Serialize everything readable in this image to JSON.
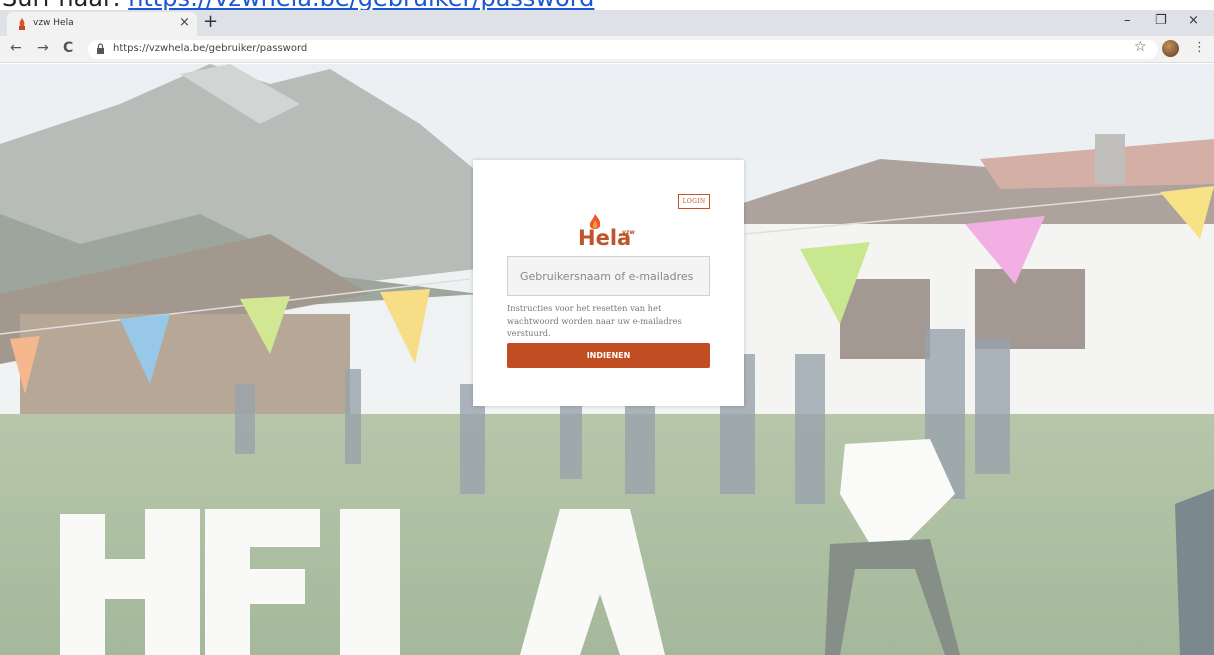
{
  "doc_header": {
    "prefix": "Surf naar:",
    "link": "https://vzwhela.be/gebruiker/password"
  },
  "browser": {
    "tab_title": "vzw Hela",
    "tab_close": "×",
    "new_tab": "+",
    "url": "https://vzwhela.be/gebruiker/password",
    "window_controls": {
      "minimize": "–",
      "restore": "❐",
      "close": "×"
    }
  },
  "nav": {
    "back": "←",
    "forward": "→",
    "reload": "C",
    "star": "☆",
    "menu": "⋮"
  },
  "card": {
    "login_label": "LOGIN",
    "logo_text": "Hela",
    "logo_vzw": "vzw",
    "input_placeholder": "Gebruikersnaam of e-mailadres",
    "instructions": "Instructies voor het resetten van het wachtwoord worden naar uw e-mailadres verstuurd.",
    "submit_label": "INDIENEN"
  },
  "colors": {
    "brand": "#c04e22",
    "tabbar": "#dee1e6",
    "toolbar": "#f2f2f2"
  }
}
